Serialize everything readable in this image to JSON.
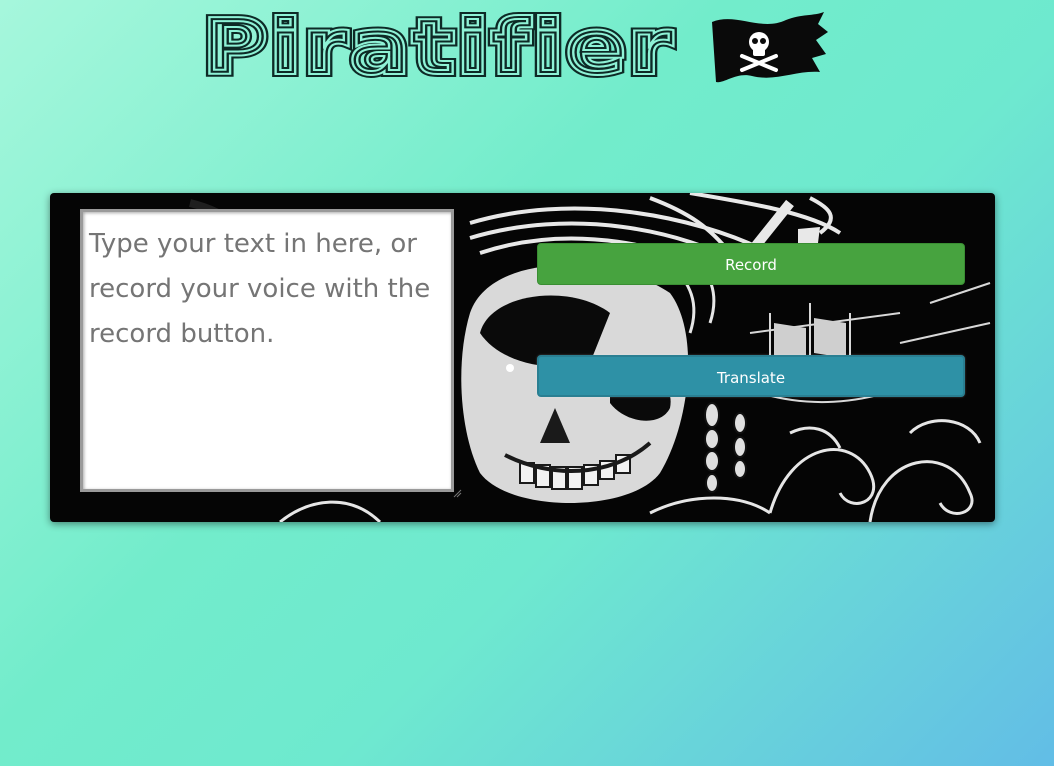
{
  "header": {
    "title": "Piratifier",
    "flag_icon": "jolly-roger-flag-icon"
  },
  "translator": {
    "input": {
      "placeholder": "Type your text in here, or record your voice with the record button.",
      "value": ""
    },
    "record_label": "Record",
    "translate_label": "Translate",
    "background_icon": "pirate-skull-illustration"
  },
  "colors": {
    "record_button": "#47a33f",
    "translate_button": "#2e91a6",
    "panel_background": "#050505",
    "page_gradient_start": "#a6f7dc",
    "page_gradient_end": "#62bde6",
    "title_stroke": "#0d2a26"
  }
}
